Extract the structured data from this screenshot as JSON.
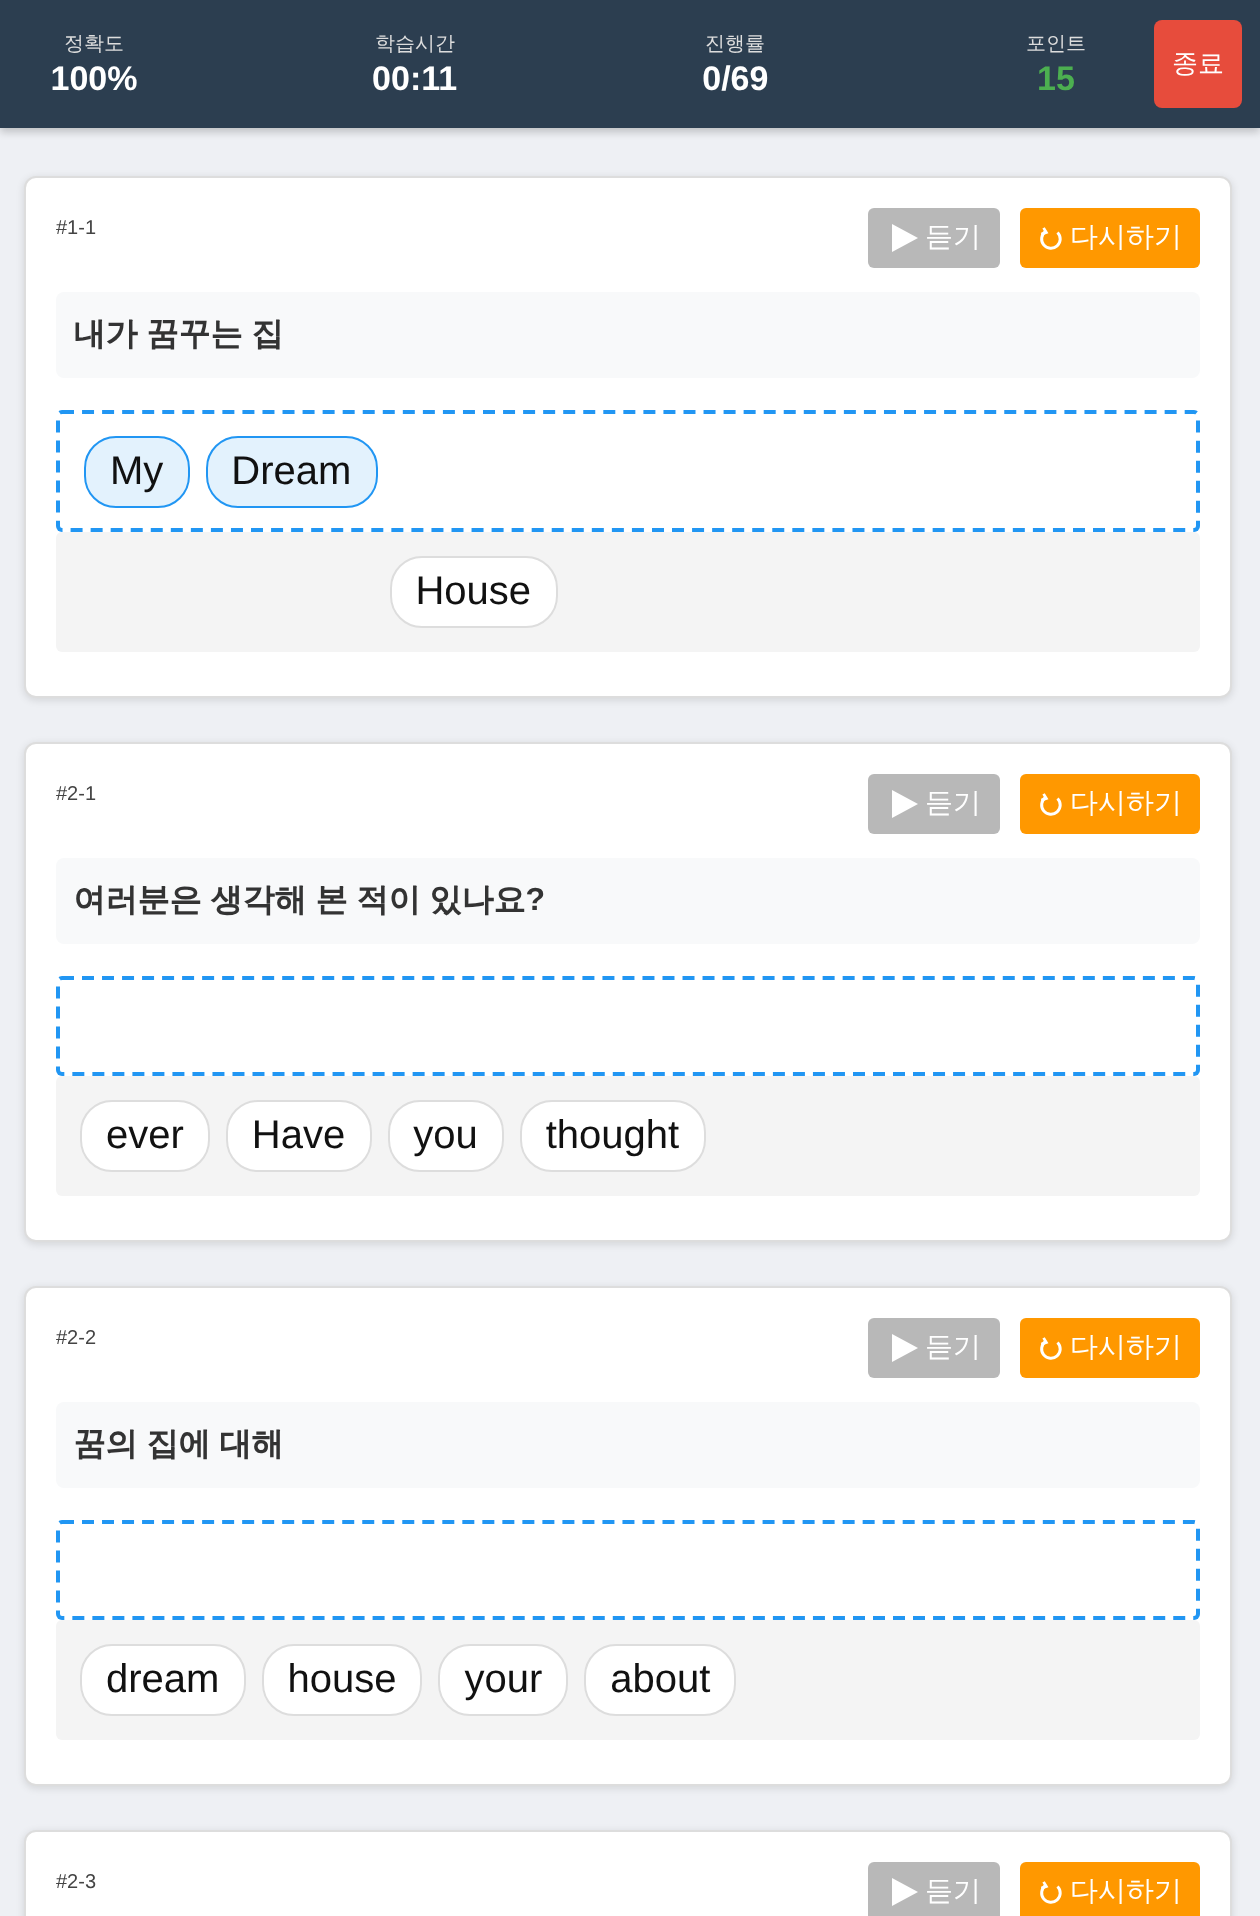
{
  "stats": [
    {
      "label": "정확도",
      "value": "100%",
      "color": "#ffffff"
    },
    {
      "label": "학습시간",
      "value": "00:11",
      "color": "#ffffff"
    },
    {
      "label": "진행률",
      "value": "0/69",
      "color": "#ffffff"
    },
    {
      "label": "포인트",
      "value": "15",
      "color": "#4caf50"
    }
  ],
  "exit_button": "종료",
  "cards": [
    {
      "id": "#1-1",
      "listen": {
        "label": "듣기",
        "disabled": true
      },
      "retry": "다시하기",
      "prompt": "내가 꿈꾸는 집",
      "answer": [
        "My",
        "Dream"
      ],
      "bank": [
        {
          "kind": "used"
        },
        {
          "kind": "used"
        },
        {
          "kind": "word",
          "word": "House"
        }
      ]
    },
    {
      "id": "#2-1",
      "listen": {
        "label": "듣기",
        "disabled": true
      },
      "retry": "다시하기",
      "prompt": "여러분은 생각해 본 적이 있나요?",
      "bank": [
        {
          "kind": "word",
          "word": "ever"
        },
        {
          "kind": "word",
          "word": "Have"
        },
        {
          "kind": "word",
          "word": "you"
        },
        {
          "kind": "word",
          "word": "thought"
        }
      ]
    },
    {
      "id": "#2-2",
      "listen": {
        "label": "듣기",
        "disabled": true
      },
      "retry": "다시하기",
      "prompt": "꿈의 집에 대해",
      "bank": [
        {
          "kind": "word",
          "word": "dream"
        },
        {
          "kind": "word",
          "word": "house"
        },
        {
          "kind": "word",
          "word": "your"
        },
        {
          "kind": "word",
          "word": "about"
        }
      ]
    },
    {
      "id": "#2-3",
      "listen": {
        "label": "듣기",
        "disabled": true
      },
      "retry": "다시하기"
    }
  ]
}
